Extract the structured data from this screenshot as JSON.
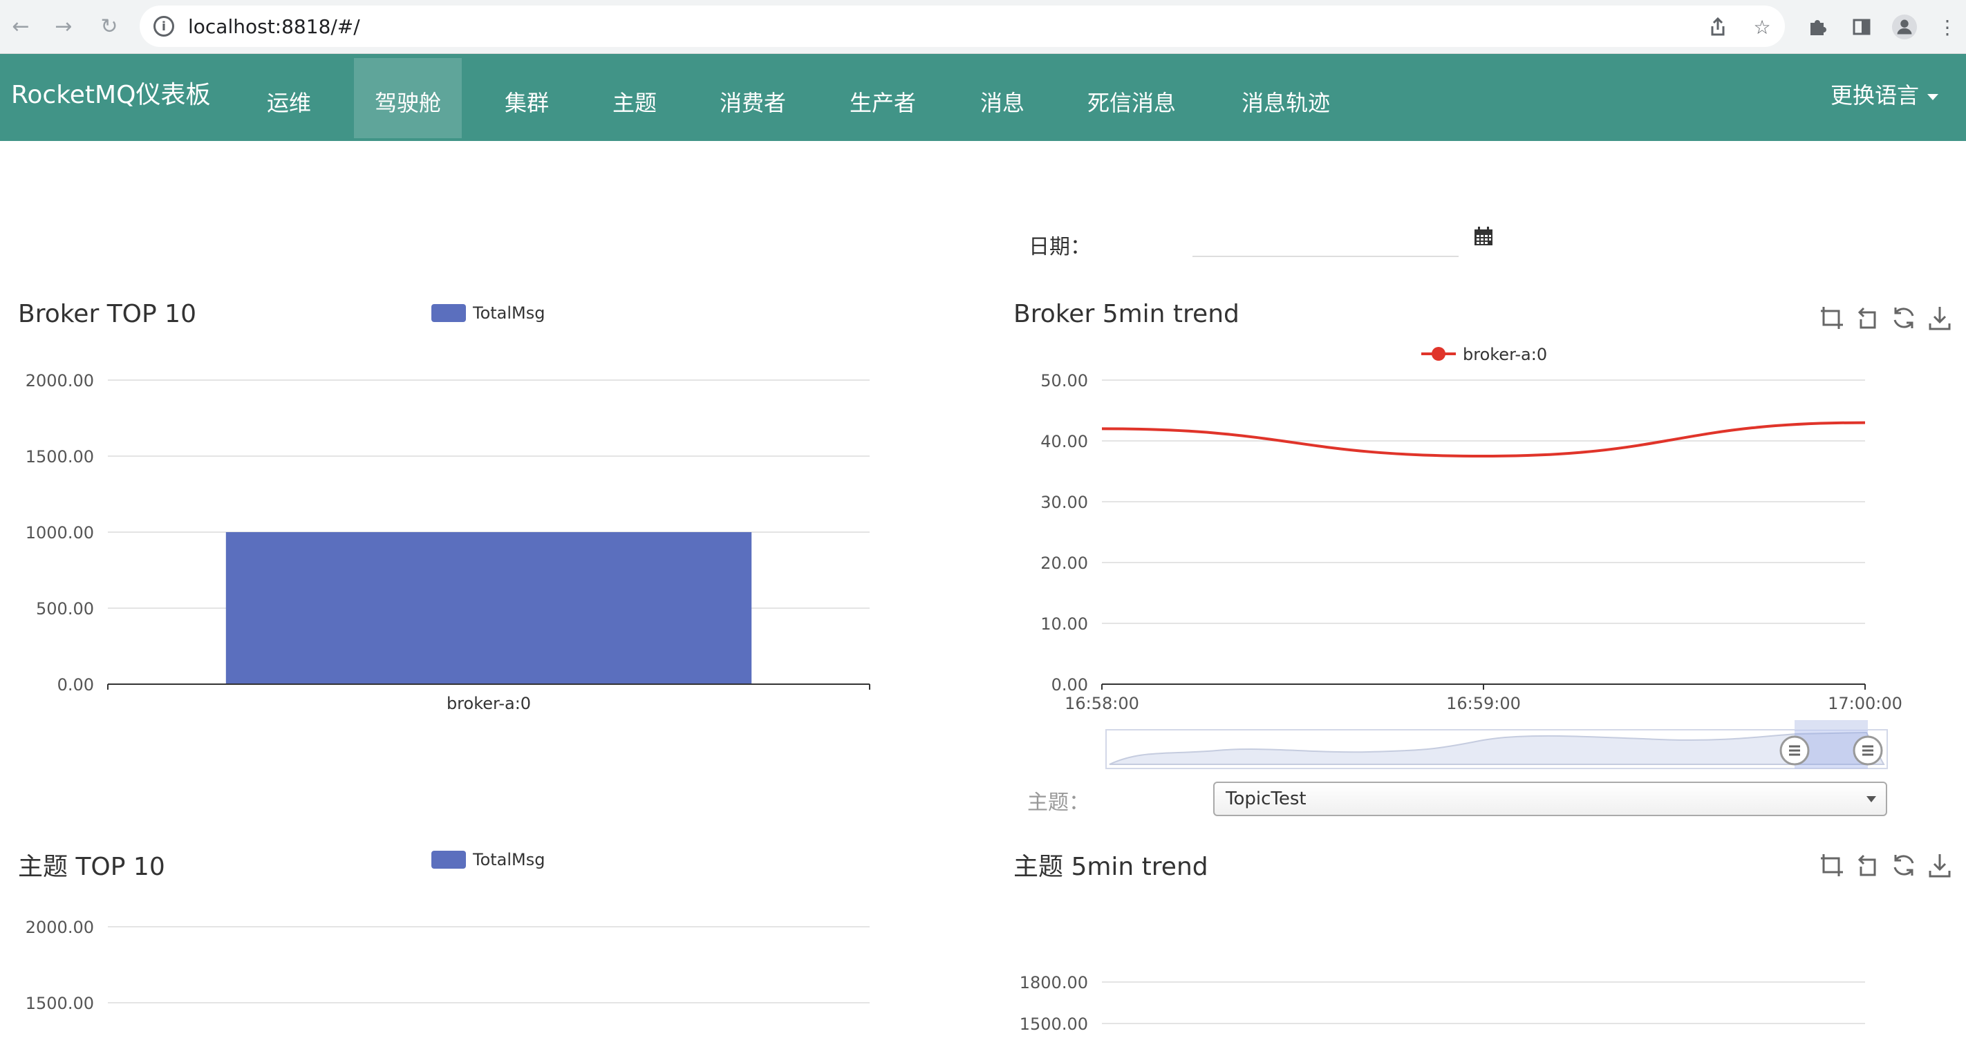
{
  "browser": {
    "url": "localhost:8818/#/",
    "icons": [
      "back-icon",
      "forward-icon",
      "reload-icon",
      "info-icon",
      "share-icon",
      "star-icon",
      "extensions-icon",
      "sidepanel-icon",
      "profile-icon",
      "menu-dots-icon"
    ]
  },
  "navbar": {
    "brand": "RocketMQ仪表板",
    "items": [
      "运维",
      "驾驶舱",
      "集群",
      "主题",
      "消费者",
      "生产者",
      "消息",
      "死信消息",
      "消息轨迹"
    ],
    "active_index": 1,
    "language": "更换语言",
    "bg_color": "#419487"
  },
  "filters": {
    "date_label": "日期：",
    "date_value": "",
    "topic_label": "主题：",
    "topic_value": "TopicTest"
  },
  "panels": {
    "broker_top": {
      "title": "Broker TOP 10"
    },
    "broker_trend": {
      "title": "Broker 5min trend"
    },
    "topic_top": {
      "title": "主题 TOP 10"
    },
    "topic_trend": {
      "title": "主题 5min trend"
    }
  },
  "chart_data": [
    {
      "type": "bar",
      "legend": [
        "TotalMsg"
      ],
      "categories": [
        "broker-a:0"
      ],
      "series": [
        {
          "name": "TotalMsg",
          "values": [
            1000
          ]
        }
      ],
      "ylim": [
        0,
        2000
      ],
      "yticks": [
        "0.00",
        "500.00",
        "1000.00",
        "1500.00",
        "2000.00"
      ],
      "color": "#5b6fbe"
    },
    {
      "type": "line",
      "legend": [
        "broker-a:0"
      ],
      "x": [
        "16:58:00",
        "16:59:00",
        "17:00:00"
      ],
      "series": [
        {
          "name": "broker-a:0",
          "values": [
            42,
            37.5,
            43
          ]
        }
      ],
      "ylim": [
        0,
        50
      ],
      "yticks": [
        "0.00",
        "10.00",
        "20.00",
        "30.00",
        "40.00",
        "50.00"
      ],
      "xticks": [
        "16:58:00",
        "16:59:00",
        "17:00:00"
      ],
      "color": "#e0342a"
    },
    {
      "type": "bar",
      "legend": [
        "TotalMsg"
      ],
      "categories": [],
      "series": [
        {
          "name": "TotalMsg",
          "values": []
        }
      ],
      "yticks": [
        "1500.00",
        "2000.00"
      ],
      "color": "#5b6fbe"
    },
    {
      "type": "line",
      "legend": [],
      "series": [],
      "yticks": [
        "1500.00",
        "1800.00"
      ]
    }
  ]
}
